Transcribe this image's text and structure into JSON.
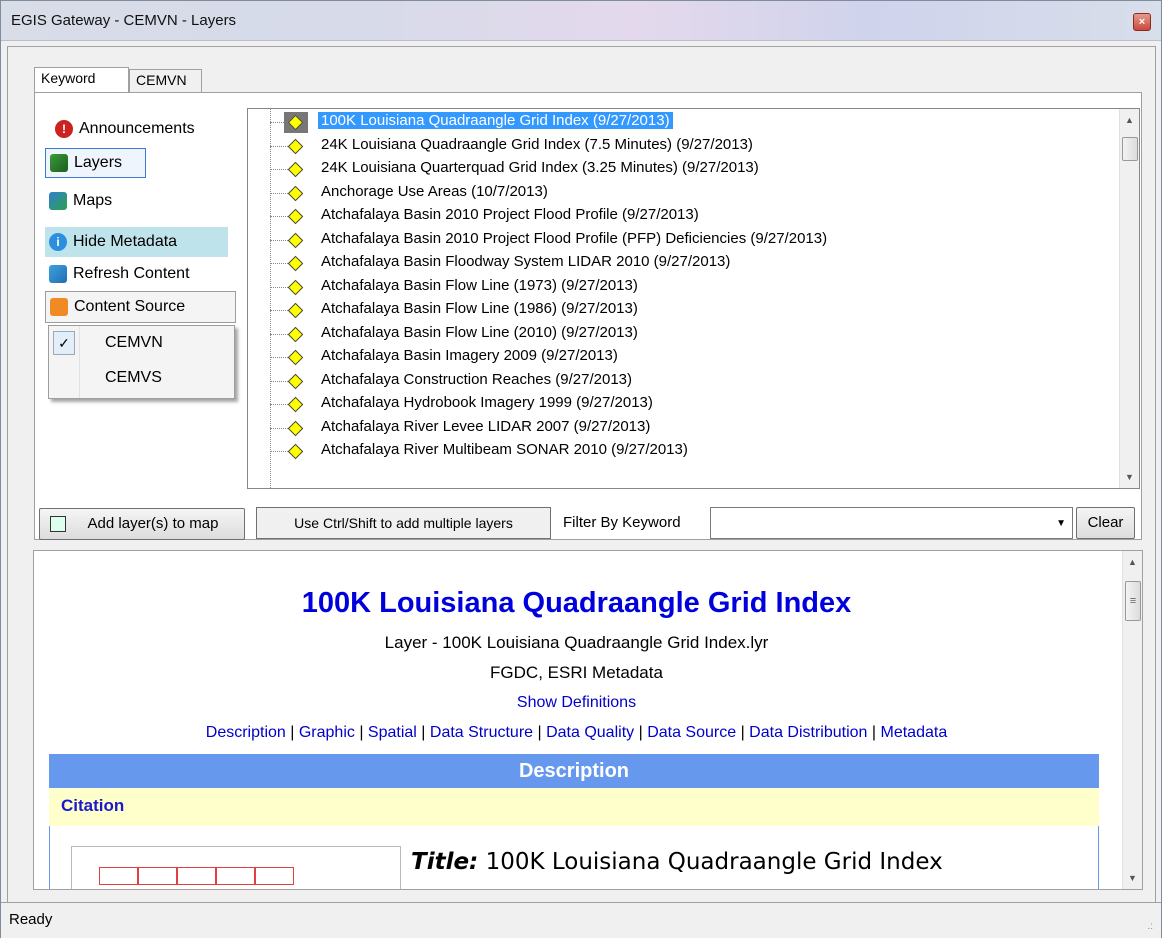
{
  "window": {
    "title": "EGIS Gateway - CEMVN - Layers",
    "close_glyph": "×"
  },
  "tabs": [
    {
      "label": "Keyword"
    },
    {
      "label": "CEMVN"
    }
  ],
  "sidebar": {
    "announcements": "Announcements",
    "layers": "Layers",
    "maps": "Maps",
    "hide_metadata": "Hide Metadata",
    "refresh_content": "Refresh Content",
    "content_source": "Content Source"
  },
  "content_source_menu": {
    "items": [
      {
        "label": "CEMVN",
        "checked": true
      },
      {
        "label": "CEMVS",
        "checked": false
      }
    ],
    "check_glyph": "✓"
  },
  "layer_tree": {
    "items": [
      "100K Louisiana Quadraangle Grid Index (9/27/2013)",
      "24K Louisiana Quadraangle Grid Index (7.5 Minutes) (9/27/2013)",
      "24K Louisiana Quarterquad Grid Index (3.25 Minutes) (9/27/2013)",
      "Anchorage Use Areas (10/7/2013)",
      "Atchafalaya Basin 2010 Project Flood Profile (9/27/2013)",
      "Atchafalaya Basin 2010 Project Flood Profile (PFP) Deficiencies (9/27/2013)",
      "Atchafalaya Basin Floodway System LIDAR 2010 (9/27/2013)",
      "Atchafalaya Basin Flow Line (1973) (9/27/2013)",
      "Atchafalaya Basin Flow Line (1986) (9/27/2013)",
      "Atchafalaya Basin Flow Line (2010) (9/27/2013)",
      "Atchafalaya Basin Imagery 2009 (9/27/2013)",
      "Atchafalaya Construction Reaches (9/27/2013)",
      "Atchafalaya Hydrobook Imagery 1999 (9/27/2013)",
      "Atchafalaya River Levee LIDAR 2007 (9/27/2013)",
      "Atchafalaya River Multibeam SONAR 2010 (9/27/2013)"
    ],
    "selected_index": 0,
    "scroll_up_glyph": "▲",
    "scroll_down_glyph": "▼"
  },
  "toolbar": {
    "add_layers": "Add layer(s) to map",
    "hint": "Use Ctrl/Shift to add multiple layers",
    "filter_label": "Filter By Keyword",
    "filter_value": "",
    "dropdown_glyph": "▼",
    "clear": "Clear"
  },
  "metadata": {
    "title": "100K Louisiana Quadraangle Grid Index",
    "layer_line": "Layer - 100K Louisiana Quadraangle Grid Index.lyr",
    "format_line": "FGDC, ESRI Metadata",
    "show_definitions": "Show Definitions",
    "links": [
      "Description",
      "Graphic",
      "Spatial",
      "Data Structure",
      "Data Quality",
      "Data Source",
      "Data Distribution",
      "Metadata"
    ],
    "link_separator": " | ",
    "section_header": "Description",
    "subsection": "Citation",
    "title_field_label": "Title:",
    "title_field_value": "100K Louisiana Quadraangle Grid Index",
    "scroll_up_glyph": "▲",
    "scroll_down_glyph": "▼",
    "thumb_glyph": "≡"
  },
  "status": {
    "text": "Ready",
    "grip_glyph": ".:"
  },
  "colors": {
    "selection": "#3399ff",
    "link": "#0000cc",
    "title": "#0000dd",
    "section_band": "#6699ee",
    "citation_band": "#ffffcc"
  }
}
